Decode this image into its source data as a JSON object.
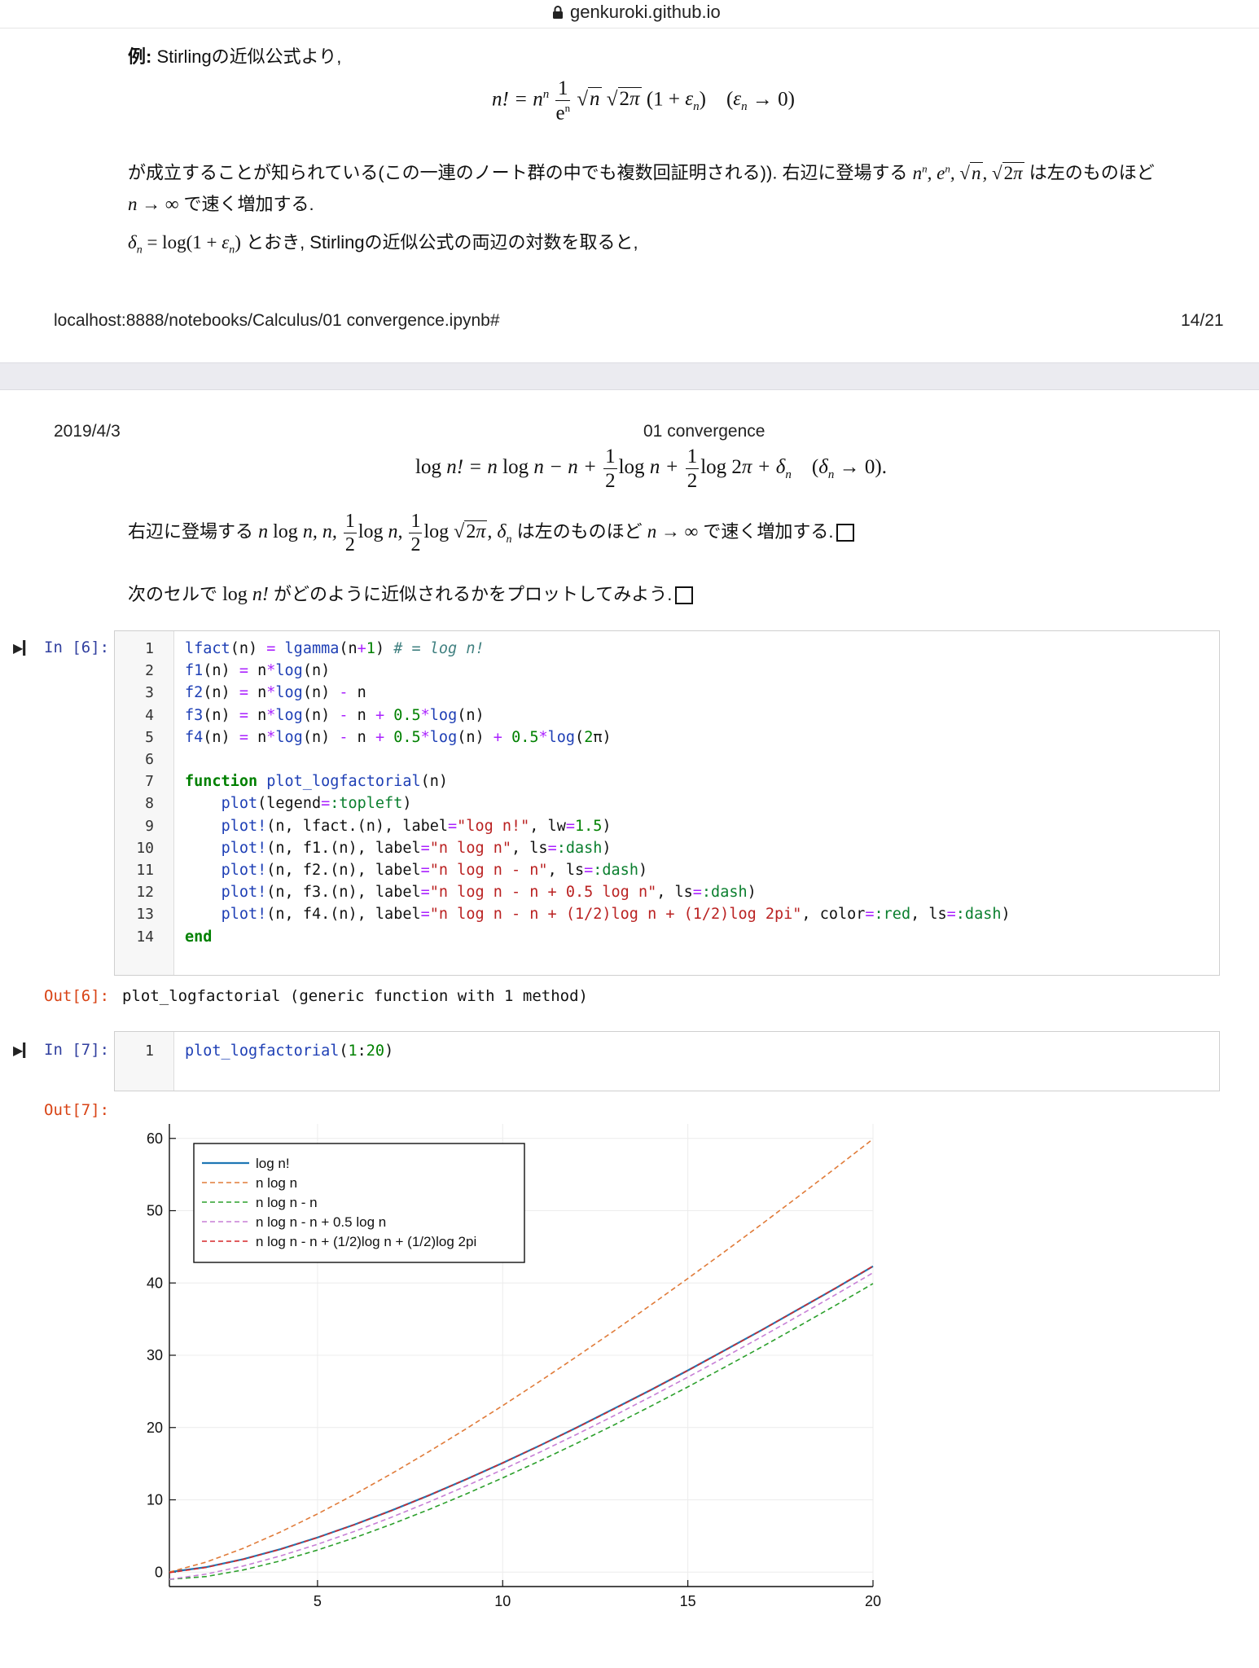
{
  "browser": {
    "url": "genkuroki.github.io"
  },
  "page1": {
    "example_prefix": "例:",
    "example_text": " Stirlingの近似公式より,",
    "para2_line1": "が成立することが知られている(この一連のノート群の中でも複数回証明される)). 右辺に登場する",
    "para2_line1_tail": "は左のものほど",
    "para2_line2": "で速く増加する.",
    "para3_tail": "とおき, Stirlingの近似公式の両辺の対数を取ると,",
    "footer_left": "localhost:8888/notebooks/Calculus/01 convergence.ipynb#",
    "footer_right": "14/21"
  },
  "page2": {
    "header_date": "2019/4/3",
    "header_title": "01 convergence",
    "para1_prefix": "右辺に登場する",
    "para1_tail": "は左のものほど",
    "para1_tail2": "で速く増加する.",
    "para2_prefix": "次のセルで",
    "para2_tail": "がどのように近似されるかをプロットしてみよう."
  },
  "cells": [
    {
      "prompt": "In [6]:",
      "line_numbers": [
        "1",
        "2",
        "3",
        "4",
        "5",
        "6",
        "7",
        "8",
        "9",
        "10",
        "11",
        "12",
        "13",
        "14"
      ],
      "output_prompt": "Out[6]:",
      "output_text": "plot_logfactorial (generic function with 1 method)"
    },
    {
      "prompt": "In [7]:",
      "line_numbers": [
        "1"
      ],
      "code": "plot_logfactorial(1:20)",
      "output_prompt": "Out[7]:"
    }
  ],
  "chart_data": {
    "type": "line",
    "title": "",
    "xlabel": "",
    "ylabel": "",
    "xlim": [
      1,
      20
    ],
    "ylim": [
      -2,
      62
    ],
    "x_ticks": [
      5,
      10,
      15,
      20
    ],
    "y_ticks": [
      0,
      10,
      20,
      30,
      40,
      50,
      60
    ],
    "grid": true,
    "legend_position": "top-left",
    "x": [
      1,
      2,
      3,
      4,
      5,
      6,
      7,
      8,
      9,
      10,
      11,
      12,
      13,
      14,
      15,
      16,
      17,
      18,
      19,
      20
    ],
    "series": [
      {
        "name": "log n!",
        "color": "#1f77b4",
        "style": "solid",
        "values": [
          0,
          0.69,
          1.79,
          3.18,
          4.79,
          6.58,
          8.53,
          10.6,
          12.8,
          15.1,
          17.5,
          20.0,
          22.6,
          25.2,
          27.9,
          30.7,
          33.5,
          36.4,
          39.3,
          42.3
        ]
      },
      {
        "name": "n log n",
        "color": "#e07b39",
        "style": "dash",
        "values": [
          0,
          1.39,
          3.3,
          5.55,
          8.05,
          10.75,
          13.62,
          16.64,
          19.78,
          23.03,
          26.38,
          29.82,
          33.34,
          36.95,
          40.62,
          44.36,
          48.16,
          52.03,
          55.94,
          59.91
        ]
      },
      {
        "name": "n log n - n",
        "color": "#2ca02c",
        "style": "dash",
        "values": [
          -1,
          -0.61,
          0.3,
          1.55,
          3.05,
          4.75,
          6.62,
          8.64,
          10.78,
          13.03,
          15.38,
          17.82,
          20.34,
          22.95,
          25.62,
          28.36,
          31.16,
          34.03,
          36.94,
          39.91
        ]
      },
      {
        "name": "n log n - n + 0.5 log n",
        "color": "#c77fd6",
        "style": "dash",
        "values": [
          -1,
          -0.27,
          0.85,
          2.24,
          3.85,
          5.64,
          7.59,
          9.68,
          11.88,
          14.18,
          16.58,
          19.06,
          21.62,
          24.27,
          26.97,
          29.75,
          32.58,
          35.48,
          38.41,
          41.41
        ]
      },
      {
        "name": "n log n - n + (1/2)log n + (1/2)log 2pi",
        "color": "#d62728",
        "style": "dash",
        "values": [
          -0.08,
          0.65,
          1.77,
          3.16,
          4.77,
          6.56,
          8.51,
          10.6,
          12.8,
          15.1,
          17.5,
          19.98,
          22.54,
          25.19,
          27.89,
          30.67,
          33.5,
          36.4,
          39.33,
          42.33
        ]
      }
    ]
  }
}
